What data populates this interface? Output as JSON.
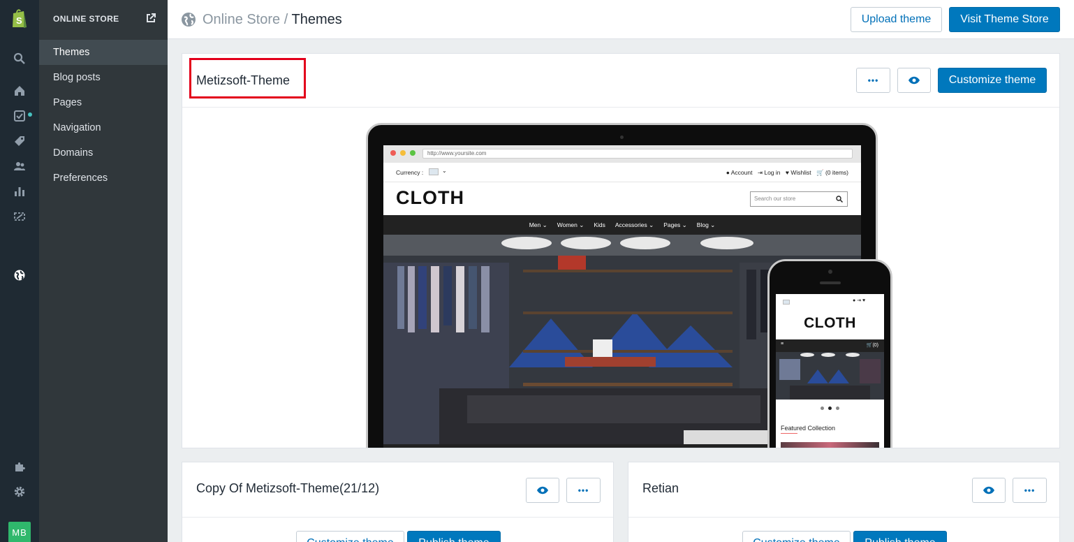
{
  "rail": {
    "icons": [
      "shopify-logo-icon",
      "search-icon",
      "home-icon",
      "orders-icon",
      "products-icon",
      "customers-icon",
      "analytics-icon",
      "discounts-icon",
      "online-store-icon",
      "apps-icon",
      "settings-icon"
    ],
    "avatar_initials": "MB",
    "notification_color": "#47c1bf"
  },
  "subnav": {
    "header": "ONLINE STORE",
    "items": [
      {
        "label": "Themes",
        "active": true
      },
      {
        "label": "Blog posts"
      },
      {
        "label": "Pages"
      },
      {
        "label": "Navigation"
      },
      {
        "label": "Domains"
      },
      {
        "label": "Preferences"
      }
    ]
  },
  "header": {
    "breadcrumb_parent": "Online Store",
    "breadcrumb_sep": "/",
    "title": "Themes",
    "upload_label": "Upload theme",
    "visit_label": "Visit Theme Store"
  },
  "current_theme": {
    "name": "Metizsoft-Theme",
    "more_label": "•••",
    "customize_label": "Customize theme",
    "preview": {
      "url": "http://www.yoursite.com",
      "currency_label": "Currency :",
      "account": "Account",
      "login": "Log in",
      "wishlist": "Wishlist",
      "cart": "(0 items)",
      "logo": "CLOTH",
      "search_placeholder": "Search our store",
      "nav": [
        "Men",
        "Women",
        "Kids",
        "Accessories",
        "Pages",
        "Blog"
      ],
      "mobile_cart": "(0)",
      "mobile_featured": "Featured Collection"
    }
  },
  "themes": [
    {
      "name": "Copy Of Metizsoft-Theme(21/12)",
      "customize_label": "Customize theme",
      "publish_label": "Publish theme",
      "more_label": "•••"
    },
    {
      "name": "Retian",
      "customize_label": "Customize theme",
      "publish_label": "Publish theme",
      "more_label": "•••"
    }
  ],
  "colors": {
    "primary": "#0078bd",
    "link": "#0070b8",
    "rail_bg": "#1f2a33",
    "subnav_bg": "#30373b",
    "highlight": "#e3001b"
  }
}
